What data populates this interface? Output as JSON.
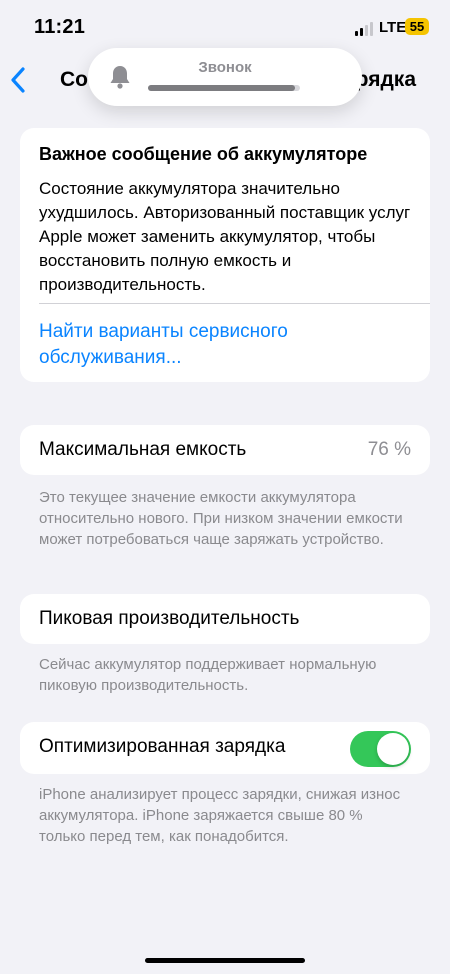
{
  "status_bar": {
    "time": "11:21",
    "network": "LTE",
    "battery_level": "55"
  },
  "nav": {
    "left_title": "Со",
    "right_title": "рядка"
  },
  "ringer_hud": {
    "label": "Звонок",
    "volume_level": 0.97
  },
  "battery_message": {
    "title": "Важное сообщение об аккумуляторе",
    "body": "Состояние аккумулятора значительно ухудшилось. Авторизованный поставщик услуг Apple может заменить аккумулятор, чтобы восстановить полную емкость и производительность.",
    "link": "Найти варианты сервисного обслуживания..."
  },
  "max_capacity": {
    "label": "Максимальная емкость",
    "value": "76 %",
    "footer": "Это текущее значение емкости аккумулятора относительно нового. При низком значении емкости может потребоваться чаще заряжать устройство."
  },
  "peak_performance": {
    "label": "Пиковая производительность",
    "footer": "Сейчас аккумулятор поддерживает нормальную пиковую производительность."
  },
  "optimized_charging": {
    "label": "Оптимизированная зарядка",
    "enabled": true,
    "footer": "iPhone анализирует процесс зарядки, снижая износ аккумулятора. iPhone заряжается свыше 80 % только перед тем, как понадобится."
  },
  "colors": {
    "accent": "#0a84ff",
    "toggle_on": "#34c759",
    "background": "#f2f2f7"
  }
}
